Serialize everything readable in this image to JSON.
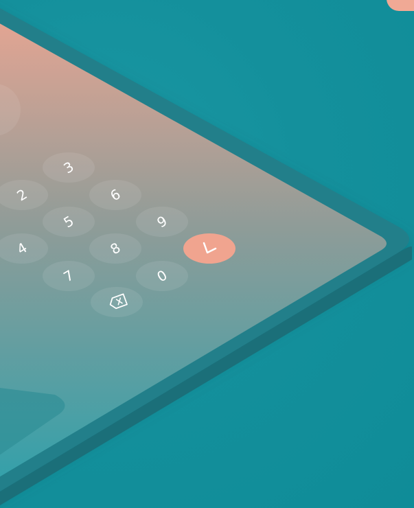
{
  "keypad": {
    "keys": [
      {
        "id": "key-3",
        "label": "3"
      },
      {
        "id": "key-2",
        "label": "2"
      },
      {
        "id": "key-6",
        "label": "6"
      },
      {
        "id": "key-5",
        "label": "5"
      },
      {
        "id": "key-9",
        "label": "9"
      },
      {
        "id": "key-4",
        "label": "4"
      },
      {
        "id": "key-8",
        "label": "8"
      },
      {
        "id": "key-7",
        "label": "7"
      },
      {
        "id": "key-0",
        "label": "0"
      }
    ],
    "confirm_icon": "check-icon",
    "delete_icon": "backspace-icon"
  },
  "colors": {
    "background": "#138e9a",
    "tablet_frame": "#237f8a",
    "screen_top": "#e8a592",
    "screen_bottom": "#2fa1ab",
    "accent": "#f0a48f"
  }
}
